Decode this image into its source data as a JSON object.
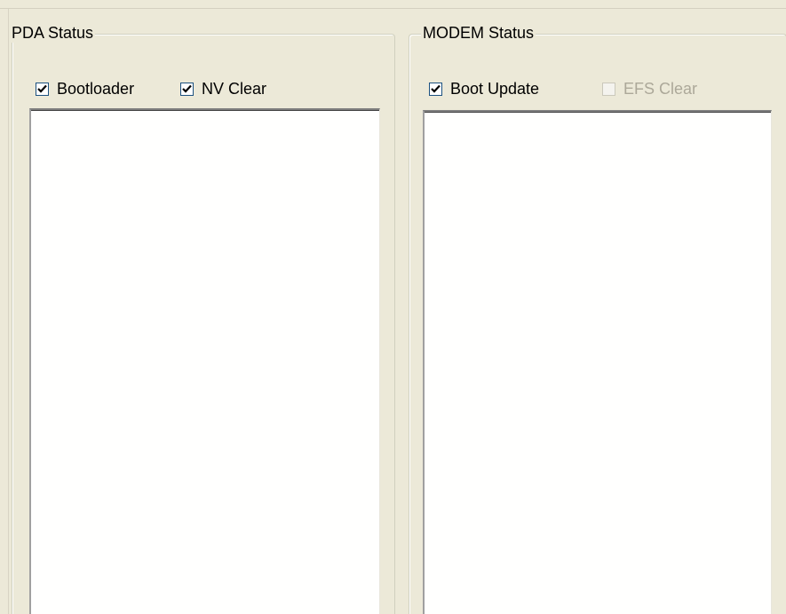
{
  "pda_status": {
    "title": "PDA Status",
    "options": [
      {
        "label": "Bootloader",
        "checked": true,
        "enabled": true
      },
      {
        "label": "NV Clear",
        "checked": true,
        "enabled": true
      }
    ],
    "log_lines": []
  },
  "modem_status": {
    "title": "MODEM Status",
    "options": [
      {
        "label": "Boot Update",
        "checked": true,
        "enabled": true
      },
      {
        "label": "EFS Clear",
        "checked": false,
        "enabled": false
      }
    ],
    "log_lines": []
  },
  "icons": {
    "checked": "check-icon"
  },
  "colors": {
    "window_background": "#ece9d8",
    "checkbox_border": "#1c5180",
    "disabled_text": "#aca899"
  }
}
